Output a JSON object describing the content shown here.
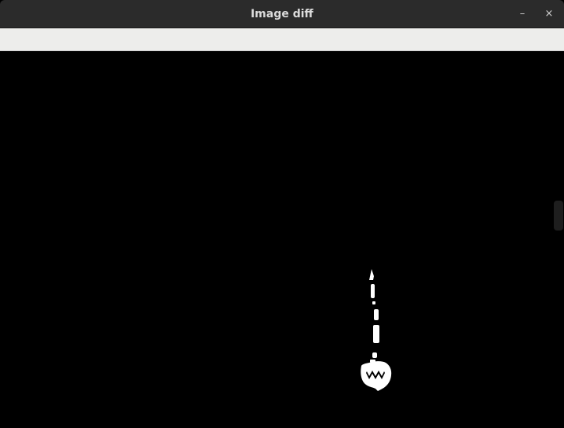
{
  "window": {
    "title": "Image diff",
    "minimize_label": "–",
    "close_label": "×"
  },
  "icons": {
    "minimize": "minimize-icon",
    "close": "close-icon"
  },
  "colors": {
    "titlebar": "#2b2b2b",
    "toolbar": "#ededeb",
    "canvas": "#000000",
    "diff_pixels": "#ffffff"
  }
}
